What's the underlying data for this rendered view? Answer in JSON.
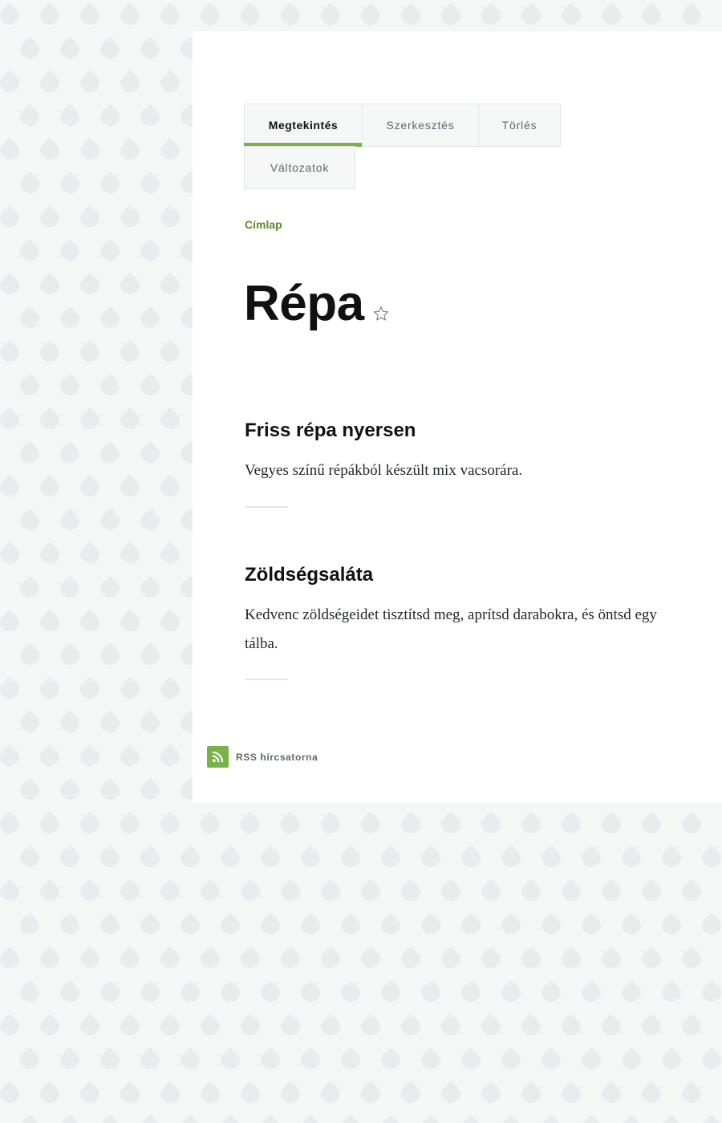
{
  "tabs": [
    {
      "label": "Megtekintés",
      "active": true
    },
    {
      "label": "Szerkesztés",
      "active": false
    },
    {
      "label": "Törlés",
      "active": false
    },
    {
      "label": "Változatok",
      "active": false
    }
  ],
  "breadcrumb": {
    "label": "Címlap"
  },
  "page": {
    "title": "Répa",
    "favorite_icon": "star-outline-icon"
  },
  "teasers": [
    {
      "title": "Friss répa nyersen",
      "summary": "Vegyes színű répákból készült mix vacsorára."
    },
    {
      "title": "Zöldségsaláta",
      "summary": "Kedvenc zöldségeidet tisztítsd meg, aprítsd darabokra, és öntsd egy tálba."
    }
  ],
  "feed": {
    "label": "RSS hírcsatorna",
    "icon": "rss-icon"
  },
  "colors": {
    "accent": "#77b347",
    "link": "#5f8d2d",
    "background": "#f5f6f6",
    "pattern": "#e9ecef"
  }
}
